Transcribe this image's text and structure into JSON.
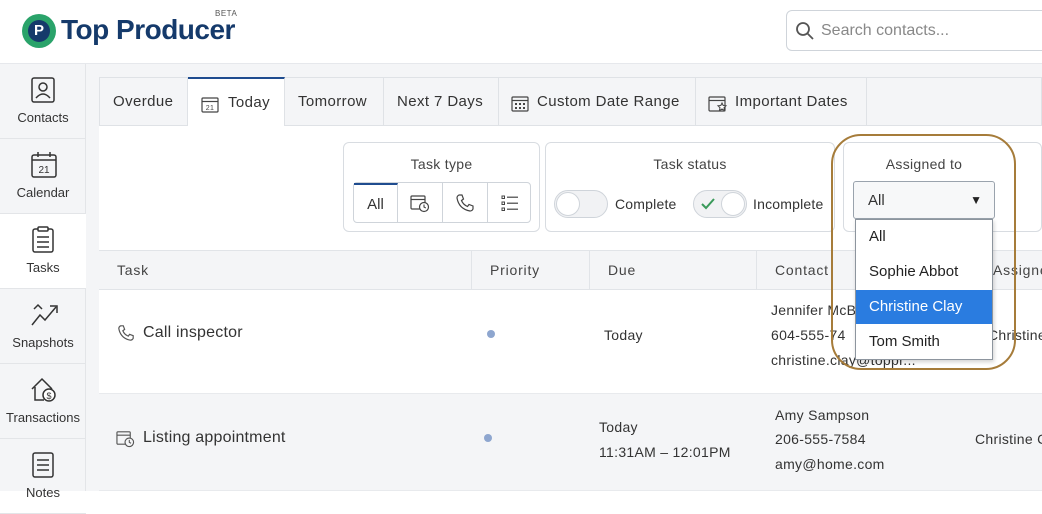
{
  "header": {
    "brand": "Top Producer",
    "beta": "BETA",
    "logo_letter": "P",
    "search_placeholder": "Search contacts..."
  },
  "sidebar": {
    "items": [
      {
        "label": "Contacts",
        "icon": "contacts-icon"
      },
      {
        "label": "Calendar",
        "icon": "calendar-icon",
        "day": "21"
      },
      {
        "label": "Tasks",
        "icon": "tasks-icon",
        "active": true
      },
      {
        "label": "Snapshots",
        "icon": "snapshots-icon"
      },
      {
        "label": "Transactions",
        "icon": "transactions-icon"
      },
      {
        "label": "Notes",
        "icon": "notes-icon"
      }
    ]
  },
  "tabs": [
    {
      "label": "Overdue"
    },
    {
      "label": "Today",
      "active": true
    },
    {
      "label": "Tomorrow"
    },
    {
      "label": "Next 7 Days"
    },
    {
      "label": "Custom Date Range"
    },
    {
      "label": "Important Dates"
    }
  ],
  "filters": {
    "task_type": {
      "title": "Task type",
      "all_label": "All"
    },
    "task_status": {
      "title": "Task status",
      "complete_label": "Complete",
      "incomplete_label": "Incomplete"
    },
    "assigned_to": {
      "title": "Assigned to",
      "selected": "All",
      "options": [
        "All",
        "Sophie Abbot",
        "Christine Clay",
        "Tom Smith"
      ],
      "highlighted": "Christine Clay"
    }
  },
  "table": {
    "columns": [
      "Task",
      "Priority",
      "Due",
      "Contact",
      "Assigned"
    ],
    "rows": [
      {
        "task": "Call inspector",
        "icon": "phone-icon",
        "due": [
          "Today"
        ],
        "contact": [
          "Jennifer McB",
          "604-555-74",
          "christine.clay@toppr..."
        ],
        "assigned": "Christine C"
      },
      {
        "task": "Listing appointment",
        "icon": "calendar-clock-icon",
        "due": [
          "Today",
          "11:31AM – 12:01PM"
        ],
        "contact": [
          "Amy Sampson",
          "206-555-7584",
          "amy@home.com"
        ],
        "assigned": "Christine C"
      }
    ]
  },
  "colors": {
    "brand_navy": "#153a6b",
    "brand_green": "#2aa36a",
    "accent_blue": "#1f4c8f",
    "selected_option": "#2a7ce0",
    "highlight_ring": "#a67c3a"
  }
}
